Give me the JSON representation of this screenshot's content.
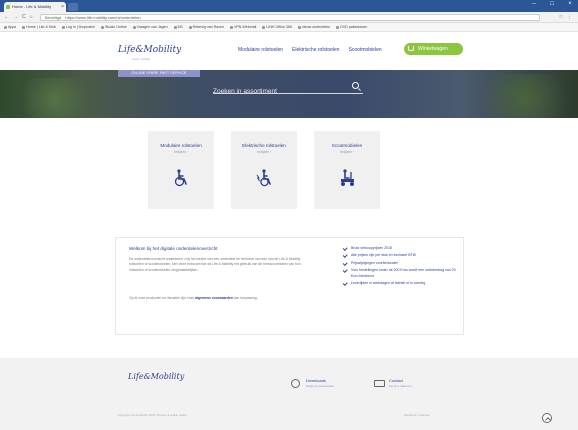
{
  "browser": {
    "tab_title": "Home - Life & Mobility",
    "tab_close": "×",
    "window_controls": [
      "–",
      "□",
      "×"
    ],
    "nav_buttons": [
      "←",
      "→",
      "C",
      "⌂"
    ],
    "secure_label": "Beveiligd",
    "url": "https://www.life-mobility.com/nl/onderdelen",
    "toolbar_icons": [
      "☆",
      "⋮"
    ],
    "bookmarks": [
      "Apps",
      "Home | Life & Mob",
      "Log in | Dropcatch",
      "Studio Online",
      "Vraagen van Jagen",
      "M3",
      "Rekenig van Raven",
      "VPN Webmail",
      "LINH Office 365",
      "nieuw onderdelen",
      "DVD pakketdoen"
    ]
  },
  "header": {
    "logo": "Life&Mobility",
    "logo_sub": "enjoy mobility",
    "nav": [
      "Modulaire rolstoelen",
      "Elektrische rolstoelen",
      "Scootmobielen"
    ],
    "cart_label": "Winkelwagen"
  },
  "hero": {
    "tag": "ONLINE SPARE PART SERVICE",
    "search_placeholder": "Zoeken in assortiment"
  },
  "categories": [
    {
      "title": "Modulaire rolstoelen",
      "sub": "bekijken ›"
    },
    {
      "title": "Elektrische rolstoelen",
      "sub": "bekijken ›"
    },
    {
      "title": "Scootmobielen",
      "sub": "bekijken ›"
    }
  ],
  "info": {
    "title": "Welkom bij het digitale onderdelenoverzicht",
    "p1": "De onderdelenoverzicht onderdelen u bij het kiezen van een onderdeel ter behoeve van een van de Life & Mobility rolstoelen of scootmobielen. Met deze extra service wil Life & Mobility het gebruik van de hersscootmobiel van hun rolstoelen of scootmobielen vergemakkelijken.",
    "p2_prefix": "Op al onze producten en diensten zijn onze",
    "p2_link": "algemene voorwaarden",
    "p2_suffix": "van toepassing.",
    "checks": [
      "Bruto verkoopprijzen 2018",
      "Alle prijzen zijn per stuk en exclusief BTW",
      "Prijswijzigingen voorbehouden",
      "Voor bestellingen onder de 200 Euro wordt een orderbedrag van 20 Euro berekend",
      "Levertijden in werkdagen af fabriek of in overleg"
    ]
  },
  "footer": {
    "logo": "Life&Mobility",
    "downloads_label": "Downloads",
    "downloads_link": "bekijk de downloads ›",
    "contact_label": "Contact",
    "contact_link": "bel of e-mail ons ›",
    "copyright": "Copyright Life & Mobility 2018  |  Privacy & cookie beleid",
    "legal": "Disclaimer  |  Sitemap"
  }
}
